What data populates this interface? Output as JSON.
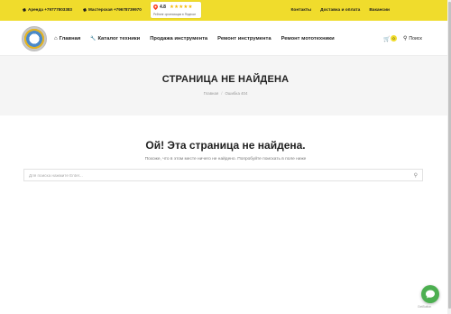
{
  "topbar": {
    "contacts": [
      {
        "label": "Аренда +79777803383"
      },
      {
        "label": "Мастерская +79678739970"
      }
    ],
    "rating": {
      "score": "4.8",
      "stars": "★★★★★",
      "caption": "Рейтинг организации в Яндексе"
    },
    "links": [
      "Контакты",
      "Доставка и оплата",
      "Вакансии"
    ]
  },
  "header": {
    "nav": [
      {
        "icon": "home-icon",
        "glyph": "⌂",
        "label": "Главная"
      },
      {
        "icon": "wrench-icon",
        "glyph": "🔧",
        "label": "Каталог техники"
      },
      {
        "icon": "",
        "glyph": "",
        "label": "Продажа инструмента"
      },
      {
        "icon": "",
        "glyph": "",
        "label": "Ремонт инструмента"
      },
      {
        "icon": "",
        "glyph": "",
        "label": "Ремонт мототехники"
      }
    ],
    "cart_count": "0",
    "search_label": "Поиск"
  },
  "banner": {
    "title": "СТРАНИЦА НЕ НАЙДЕНА",
    "breadcrumb": [
      "Главная",
      "Ошибка 404"
    ]
  },
  "main": {
    "title": "Ой! Эта страница не найдена.",
    "description": "Похоже, что в этом месте ничего не найдено. Попробуйте поискать в поле ниже",
    "search_placeholder": "Для поиска нажмите Enter..."
  },
  "chat": {
    "label": "GetButton"
  },
  "colors": {
    "accent": "#f0dc2c",
    "chat": "#4caf50"
  }
}
